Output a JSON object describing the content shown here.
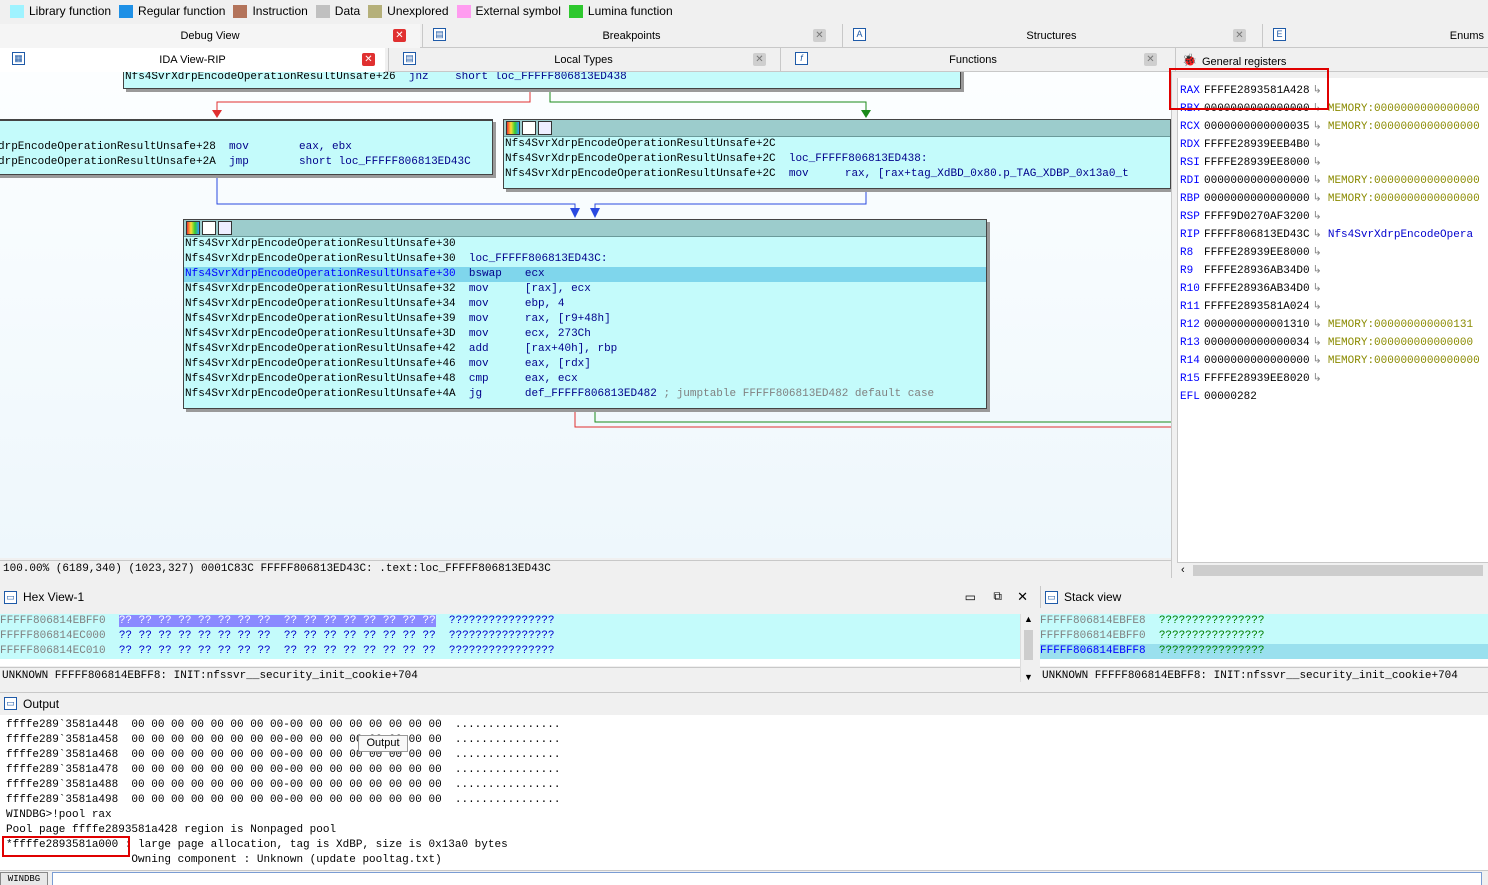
{
  "legend": [
    {
      "label": "Library function",
      "color": "#9ff3ff"
    },
    {
      "label": "Regular function",
      "color": "#1e90e6"
    },
    {
      "label": "Instruction",
      "color": "#b3735a"
    },
    {
      "label": "Data",
      "color": "#c0c0c0"
    },
    {
      "label": "Unexplored",
      "color": "#b5b07a"
    },
    {
      "label": "External symbol",
      "color": "#ff9cf0"
    },
    {
      "label": "Lumina function",
      "color": "#2ec82e"
    }
  ],
  "tabs_top": {
    "debug_view": "Debug View",
    "breakpoints": "Breakpoints",
    "structures": "Structures",
    "enums": "Enums"
  },
  "tabs_second": {
    "ida_view": "IDA View-RIP",
    "local_types": "Local Types",
    "functions": "Functions",
    "general_registers": "General registers"
  },
  "graph": {
    "top_node": {
      "addr": "Nfs4SvrXdrpEncodeOperationResultUnsafe+26",
      "mnem": "jnz",
      "op": "short loc_FFFFF806813ED438"
    },
    "left_node": [
      {
        "addr": "drpEncodeOperationResultUnsafe+28",
        "mnem": "mov",
        "op": "eax, ebx"
      },
      {
        "addr": "drpEncodeOperationResultUnsafe+2A",
        "mnem": "jmp",
        "op": "short loc_FFFFF806813ED43C"
      }
    ],
    "right_node": [
      {
        "addr": "Nfs4SvrXdrpEncodeOperationResultUnsafe+2C",
        "mnem": "",
        "op": ""
      },
      {
        "addr": "Nfs4SvrXdrpEncodeOperationResultUnsafe+2C",
        "mnem": "loc_FFFFF806813ED438:",
        "op": ""
      },
      {
        "addr": "Nfs4SvrXdrpEncodeOperationResultUnsafe+2C",
        "mnem": "mov",
        "op": "rax, [rax+tag_XdBD_0x80.p_TAG_XDBP_0x13a0_t"
      }
    ],
    "main_node": [
      {
        "addr": "Nfs4SvrXdrpEncodeOperationResultUnsafe+30",
        "mnem": "",
        "op": ""
      },
      {
        "addr": "Nfs4SvrXdrpEncodeOperationResultUnsafe+30",
        "mnem": "loc_FFFFF806813ED43C:",
        "op": ""
      },
      {
        "addr": "Nfs4SvrXdrpEncodeOperationResultUnsafe+30",
        "mnem": "bswap",
        "op": "ecx"
      },
      {
        "addr": "Nfs4SvrXdrpEncodeOperationResultUnsafe+32",
        "mnem": "mov",
        "op": "[rax], ecx"
      },
      {
        "addr": "Nfs4SvrXdrpEncodeOperationResultUnsafe+34",
        "mnem": "mov",
        "op": "ebp, 4"
      },
      {
        "addr": "Nfs4SvrXdrpEncodeOperationResultUnsafe+39",
        "mnem": "mov",
        "op": "rax, [r9+48h]"
      },
      {
        "addr": "Nfs4SvrXdrpEncodeOperationResultUnsafe+3D",
        "mnem": "mov",
        "op": "ecx, 273Ch"
      },
      {
        "addr": "Nfs4SvrXdrpEncodeOperationResultUnsafe+42",
        "mnem": "add",
        "op": "[rax+40h], rbp"
      },
      {
        "addr": "Nfs4SvrXdrpEncodeOperationResultUnsafe+46",
        "mnem": "mov",
        "op": "eax, [rdx]"
      },
      {
        "addr": "Nfs4SvrXdrpEncodeOperationResultUnsafe+48",
        "mnem": "cmp",
        "op": "eax, ecx"
      },
      {
        "addr": "Nfs4SvrXdrpEncodeOperationResultUnsafe+4A",
        "mnem": "jg",
        "op": "def_FFFFF806813ED482",
        "comment": "; jumptable FFFFF806813ED482 default case"
      }
    ]
  },
  "status_bar": "100.00% (6189,340) (1023,327) 0001C83C FFFFF806813ED43C: .text:loc_FFFFF806813ED43C",
  "registers": [
    {
      "name": "RAX",
      "value": "FFFFE2893581A428",
      "extra": "",
      "kind": ""
    },
    {
      "name": "RBX",
      "value": "0000000000000000",
      "extra": "MEMORY:0000000000000000",
      "kind": "mem"
    },
    {
      "name": "RCX",
      "value": "0000000000000035",
      "extra": "MEMORY:0000000000000000",
      "kind": "mem"
    },
    {
      "name": "RDX",
      "value": "FFFFE28939EEB4B0",
      "extra": "",
      "kind": ""
    },
    {
      "name": "RSI",
      "value": "FFFFE28939EE8000",
      "extra": "",
      "kind": ""
    },
    {
      "name": "RDI",
      "value": "0000000000000000",
      "extra": "MEMORY:0000000000000000",
      "kind": "mem"
    },
    {
      "name": "RBP",
      "value": "0000000000000000",
      "extra": "MEMORY:0000000000000000",
      "kind": "mem"
    },
    {
      "name": "RSP",
      "value": "FFFF9D0270AF3200",
      "extra": "",
      "kind": ""
    },
    {
      "name": "RIP",
      "value": "FFFFF806813ED43C",
      "extra": "Nfs4SvrXdrpEncodeOpera",
      "kind": "sym"
    },
    {
      "name": "R8",
      "value": "FFFFE28939EE8000",
      "extra": "",
      "kind": ""
    },
    {
      "name": "R9",
      "value": "FFFFE28936AB34D0",
      "extra": "",
      "kind": ""
    },
    {
      "name": "R10",
      "value": "FFFFE28936AB34D0",
      "extra": "",
      "kind": ""
    },
    {
      "name": "R11",
      "value": "FFFFE2893581A024",
      "extra": "",
      "kind": ""
    },
    {
      "name": "R12",
      "value": "0000000000001310",
      "extra": "MEMORY:000000000000131",
      "kind": "mem"
    },
    {
      "name": "R13",
      "value": "0000000000000034",
      "extra": "MEMORY:000000000000000",
      "kind": "mem"
    },
    {
      "name": "R14",
      "value": "0000000000000000",
      "extra": "MEMORY:0000000000000000",
      "kind": "mem"
    },
    {
      "name": "R15",
      "value": "FFFFE28939EE8020",
      "extra": "",
      "kind": ""
    },
    {
      "name": "EFL",
      "value": "00000282",
      "extra": "",
      "kind": ""
    }
  ],
  "hex_view": {
    "title": "Hex View-1",
    "rows": [
      {
        "addr": "FFFFF806814EBFF0",
        "bytes": "?? ?? ?? ?? ?? ?? ?? ??  ?? ?? ?? ?? ?? ?? ?? ??",
        "ascii": "????????????????"
      },
      {
        "addr": "FFFFF806814EC000",
        "bytes": "?? ?? ?? ?? ?? ?? ?? ??  ?? ?? ?? ?? ?? ?? ?? ??",
        "ascii": "????????????????"
      },
      {
        "addr": "FFFFF806814EC010",
        "bytes": "?? ?? ?? ?? ?? ?? ?? ??  ?? ?? ?? ?? ?? ?? ?? ??",
        "ascii": "????????????????"
      }
    ],
    "status": "UNKNOWN FFFFF806814EBFF8: INIT:nfssvr__security_init_cookie+704"
  },
  "stack_view": {
    "title": "Stack view",
    "rows": [
      {
        "addr": "FFFFF806814EBFE8",
        "ascii": "????????????????"
      },
      {
        "addr": "FFFFF806814EBFF0",
        "ascii": "????????????????"
      },
      {
        "addr": "FFFFF806814EBFF8",
        "ascii": "????????????????"
      }
    ],
    "status": "UNKNOWN FFFFF806814EBFF8: INIT:nfssvr__security_init_cookie+704"
  },
  "output": {
    "title": "Output",
    "tooltip": "Output",
    "lines": [
      "ffffe289`3581a448  00 00 00 00 00 00 00 00-00 00 00 00 00 00 00 00  ................",
      "ffffe289`3581a458  00 00 00 00 00 00 00 00-00 00 00 00 00 00 00 00  ................",
      "ffffe289`3581a468  00 00 00 00 00 00 00 00-00 00 00 00 00 00 00 00  ................",
      "ffffe289`3581a478  00 00 00 00 00 00 00 00-00 00 00 00 00 00 00 00  ................",
      "ffffe289`3581a488  00 00 00 00 00 00 00 00-00 00 00 00 00 00 00 00  ................",
      "ffffe289`3581a498  00 00 00 00 00 00 00 00-00 00 00 00 00 00 00 00  ................",
      "WINDBG>!pool rax",
      "Pool page ffffe2893581a428 region is Nonpaged pool",
      "*ffffe2893581a000 : large page allocation, tag is XdBP, size is 0x13a0 bytes",
      "                   Owning component : Unknown (update pooltag.txt)"
    ],
    "cmd_prefix": "WINDBG",
    "cmd_value": ""
  }
}
